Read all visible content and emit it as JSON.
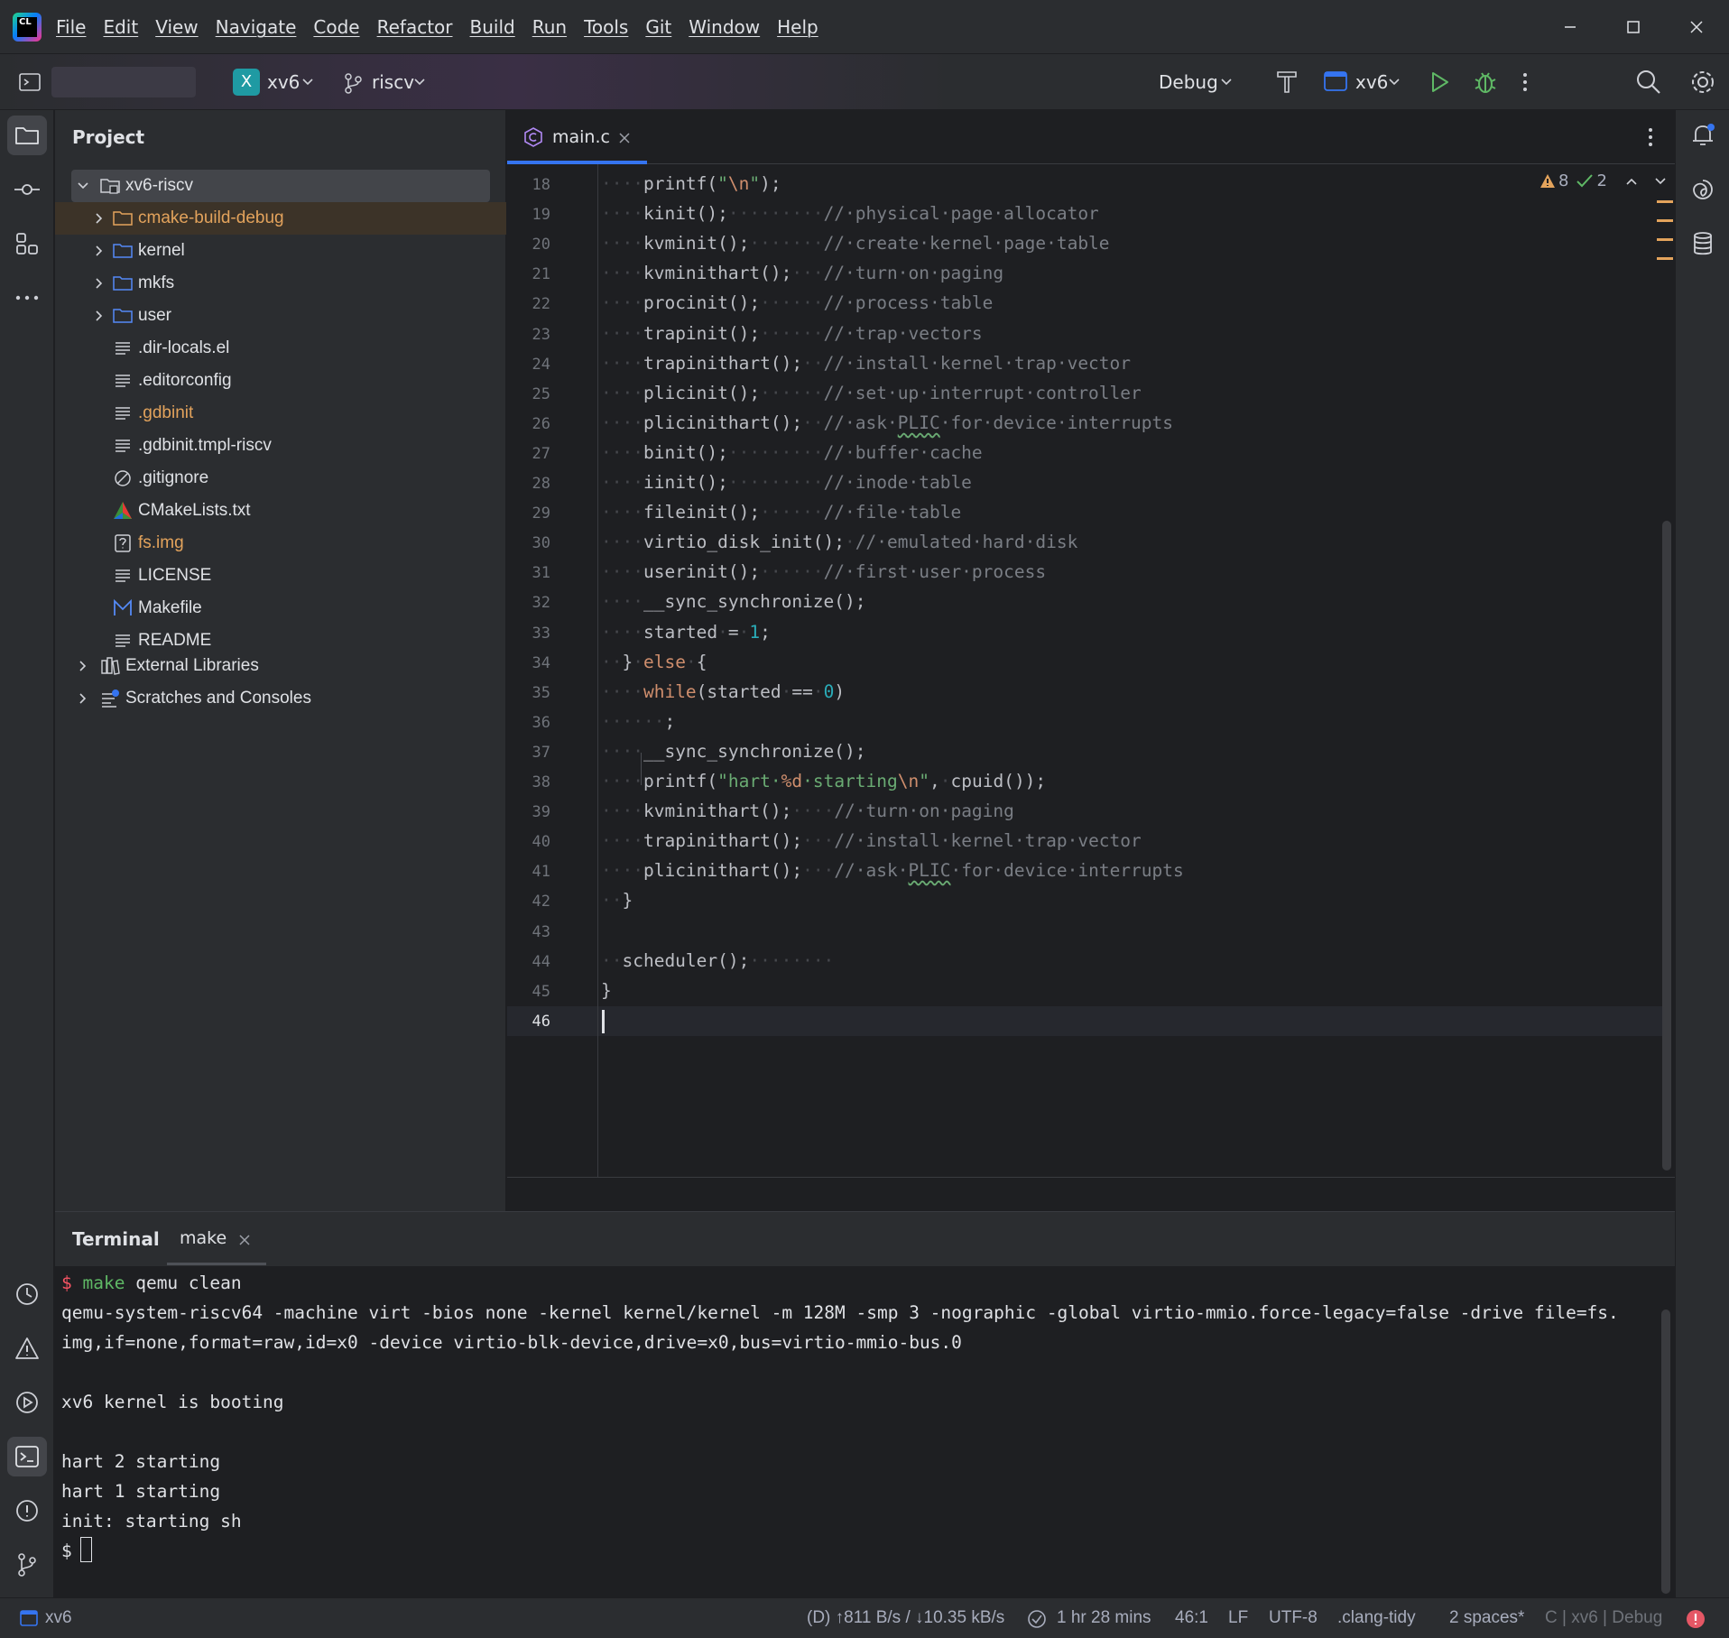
{
  "menu": [
    "File",
    "Edit",
    "View",
    "Navigate",
    "Code",
    "Refactor",
    "Build",
    "Run",
    "Tools",
    "Git",
    "Window",
    "Help"
  ],
  "toolbar": {
    "project_badge": "X",
    "project_name": "xv6",
    "branch": "riscv",
    "build_config": "Debug",
    "run_target": "xv6"
  },
  "project_panel": {
    "title": "Project",
    "root": "xv6-riscv",
    "items": [
      {
        "label": "cmake-build-debug",
        "type": "folder",
        "color": "#e3a35c"
      },
      {
        "label": "kernel",
        "type": "folder"
      },
      {
        "label": "mkfs",
        "type": "folder"
      },
      {
        "label": "user",
        "type": "folder"
      },
      {
        "label": ".dir-locals.el",
        "type": "file"
      },
      {
        "label": ".editorconfig",
        "type": "file"
      },
      {
        "label": ".gdbinit",
        "type": "file",
        "color": "#e3a35c"
      },
      {
        "label": ".gdbinit.tmpl-riscv",
        "type": "file"
      },
      {
        "label": ".gitignore",
        "type": "ignore"
      },
      {
        "label": "CMakeLists.txt",
        "type": "cmake"
      },
      {
        "label": "fs.img",
        "type": "unknown",
        "color": "#e3a35c"
      },
      {
        "label": "LICENSE",
        "type": "file"
      },
      {
        "label": "Makefile",
        "type": "makefile"
      },
      {
        "label": "README",
        "type": "file"
      }
    ],
    "external": "External Libraries",
    "scratches": "Scratches and Consoles"
  },
  "editor": {
    "tab": "main.c",
    "warnings": "8",
    "checks": "2",
    "lines": [
      {
        "n": "18",
        "html": "<span class='dot'>····</span>printf(<span class='str'>\"<span class='esc'>\\n</span>\"</span>);"
      },
      {
        "n": "19",
        "html": "<span class='dot'>····</span>kinit();<span class='dot'>·········</span><span class='cm'>//·physical·page·allocator</span>"
      },
      {
        "n": "20",
        "html": "<span class='dot'>····</span>kvminit();<span class='dot'>·······</span><span class='cm'>//·create·kernel·page·table</span>"
      },
      {
        "n": "21",
        "html": "<span class='dot'>····</span>kvminithart();<span class='dot'>···</span><span class='cm'>//·turn·on·paging</span>"
      },
      {
        "n": "22",
        "html": "<span class='dot'>····</span>procinit();<span class='dot'>······</span><span class='cm'>//·process·table</span>"
      },
      {
        "n": "23",
        "html": "<span class='dot'>····</span>trapinit();<span class='dot'>······</span><span class='cm'>//·trap·vectors</span>"
      },
      {
        "n": "24",
        "html": "<span class='dot'>····</span>trapinithart();<span class='dot'>··</span><span class='cm'>//·install·kernel·trap·vector</span>"
      },
      {
        "n": "25",
        "html": "<span class='dot'>····</span>plicinit();<span class='dot'>······</span><span class='cm'>//·set·up·interrupt·controller</span>"
      },
      {
        "n": "26",
        "html": "<span class='dot'>····</span>plicinithart();<span class='dot'>··</span><span class='cm'>//·ask·<span class='und'>PLIC</span>·for·device·interrupts</span>"
      },
      {
        "n": "27",
        "html": "<span class='dot'>····</span>binit();<span class='dot'>·········</span><span class='cm'>//·buffer·cache</span>"
      },
      {
        "n": "28",
        "html": "<span class='dot'>····</span>iinit();<span class='dot'>·········</span><span class='cm'>//·inode·table</span>"
      },
      {
        "n": "29",
        "html": "<span class='dot'>····</span>fileinit();<span class='dot'>······</span><span class='cm'>//·file·table</span>"
      },
      {
        "n": "30",
        "html": "<span class='dot'>····</span>virtio_disk_init();<span class='dot'>·</span><span class='cm'>//·emulated·hard·disk</span>"
      },
      {
        "n": "31",
        "html": "<span class='dot'>····</span>userinit();<span class='dot'>······</span><span class='cm'>//·first·user·process</span>"
      },
      {
        "n": "32",
        "html": "<span class='dot'>····</span>__sync_synchronize();"
      },
      {
        "n": "33",
        "html": "<span class='dot'>····</span>started<span class='dot'>·</span>=<span class='dot'>·</span><span class='num'>1</span>;"
      },
      {
        "n": "34",
        "html": "<span class='dot'>··</span>}<span class='dot'>·</span><span class='kw'>else</span><span class='dot'>·</span>{"
      },
      {
        "n": "35",
        "html": "<span class='dot'>····</span><span class='kw'>while</span>(started<span class='dot'>·</span>==<span class='dot'>·</span><span class='num'>0</span>)"
      },
      {
        "n": "36",
        "html": "<span class='dot'>······</span>;"
      },
      {
        "n": "37",
        "html": "<span class='dot'>····</span>__sync_synchronize();"
      },
      {
        "n": "38",
        "html": "<span class='dot'>····</span>printf(<span class='str'>\"hart·<span class='esc'>%d</span>·starting<span class='esc'>\\n</span>\"</span>,<span class='dot'>·</span>cpuid());"
      },
      {
        "n": "39",
        "html": "<span class='dot'>····</span>kvminithart();<span class='dot'>····</span><span class='cm'>//·turn·on·paging</span>"
      },
      {
        "n": "40",
        "html": "<span class='dot'>····</span>trapinithart();<span class='dot'>···</span><span class='cm'>//·install·kernel·trap·vector</span>"
      },
      {
        "n": "41",
        "html": "<span class='dot'>····</span>plicinithart();<span class='dot'>···</span><span class='cm'>//·ask·<span class='und'>PLIC</span>·for·device·interrupts</span>"
      },
      {
        "n": "42",
        "html": "<span class='dot'>··</span>}"
      },
      {
        "n": "43",
        "html": ""
      },
      {
        "n": "44",
        "html": "<span class='dot'>··</span>scheduler();<span class='dot'>········</span>"
      },
      {
        "n": "45",
        "html": "}"
      },
      {
        "n": "46",
        "html": ""
      }
    ]
  },
  "terminal": {
    "tab_title": "Terminal",
    "session_tab": "make",
    "prompt": "$",
    "command_kw": "make",
    "command_rest": " qemu clean",
    "lines": [
      "qemu-system-riscv64 -machine virt -bios none -kernel kernel/kernel -m 128M -smp 3 -nographic -global virtio-mmio.force-legacy=false -drive file=fs.",
      "img,if=none,format=raw,id=x0 -device virtio-blk-device,drive=x0,bus=virtio-mmio-bus.0",
      "",
      "xv6 kernel is booting",
      "",
      "hart 2 starting",
      "hart 1 starting",
      "init: starting sh"
    ],
    "final_prompt": "$"
  },
  "status": {
    "project": "xv6",
    "network": "(D) ↑811 B/s / ↓10.35 kB/s",
    "time": "1 hr 28 mins",
    "position": "46:1",
    "line_sep": "LF",
    "encoding": "UTF-8",
    "inspector": ".clang-tidy",
    "indent": "2 spaces*",
    "context": "C | xv6 | Debug"
  },
  "colors": {
    "accent": "#3574f0",
    "modified": "#e3a35c",
    "run": "#5fb865"
  }
}
